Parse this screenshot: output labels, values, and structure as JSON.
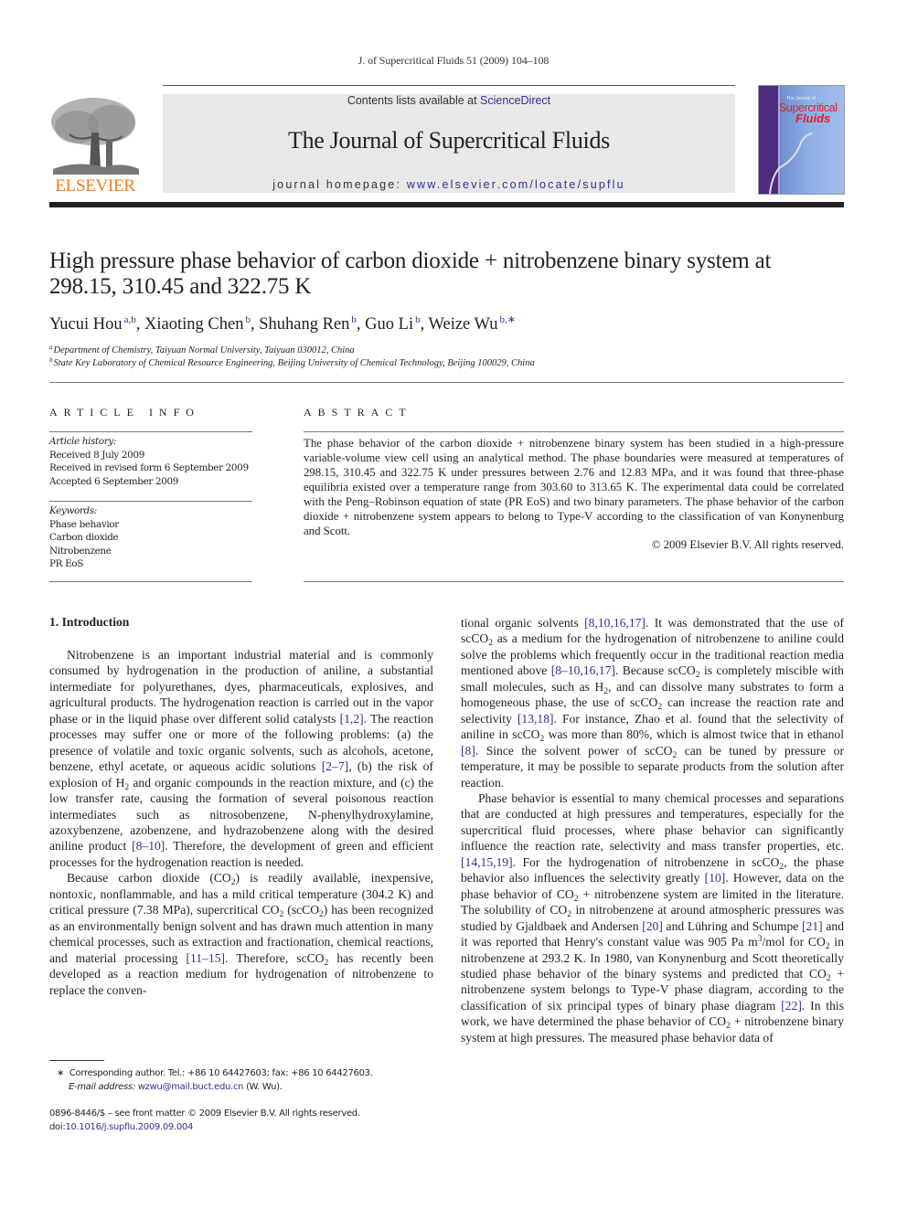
{
  "running_head": "J. of Supercritical Fluids 51 (2009) 104–108",
  "masthead": {
    "publisher_logo_text": "ELSEVIER",
    "contents_prefix": "Contents lists available at ",
    "contents_link": "ScienceDirect",
    "journal_title": "The Journal of Supercritical Fluids",
    "homepage_prefix": "journal homepage: ",
    "homepage_link": "www.elsevier.com/locate/supflu",
    "cover": {
      "small_text": "The Journal of",
      "title_line1": "Supercritical",
      "title_line2": "Fluids"
    },
    "colors": {
      "elsevier_orange": "#f47b20",
      "link_blue": "#2e3192",
      "cover_red": "#e31e24",
      "band_grey": "#e8e8e9"
    }
  },
  "article": {
    "title_line1": "High pressure phase behavior of carbon dioxide + nitrobenzene binary system at",
    "title_line2": "298.15, 310.45 and 322.75 K",
    "authors": [
      {
        "name": "Yucui Hou",
        "affil": "a,b"
      },
      {
        "name": "Xiaoting Chen",
        "affil": "b"
      },
      {
        "name": "Shuhang Ren",
        "affil": "b"
      },
      {
        "name": "Guo Li",
        "affil": "b"
      },
      {
        "name": "Weize Wu",
        "affil": "b,∗"
      }
    ],
    "affiliations": [
      {
        "mark": "a",
        "text": "Department of Chemistry, Taiyuan Normal University, Taiyuan 030012, China"
      },
      {
        "mark": "b",
        "text": "State Key Laboratory of Chemical Resource Engineering, Beijing University of Chemical Technology, Beijing 100029, China"
      }
    ]
  },
  "article_info": {
    "heading": "ARTICLE INFO",
    "history_label": "Article history:",
    "history": [
      "Received 8 July 2009",
      "Received in revised form 6 September 2009",
      "Accepted 6 September 2009"
    ],
    "keywords_label": "Keywords:",
    "keywords": [
      "Phase behavior",
      "Carbon dioxide",
      "Nitrobenzene",
      "PR EoS"
    ]
  },
  "abstract": {
    "heading": "ABSTRACT",
    "text": "The phase behavior of the carbon dioxide + nitrobenzene binary system has been studied in a high-pressure variable-volume view cell using an analytical method. The phase boundaries were measured at temperatures of 298.15, 310.45 and 322.75 K under pressures between 2.76 and 12.83 MPa, and it was found that three-phase equilibria existed over a temperature range from 303.60 to 313.65 K. The experimental data could be correlated with the Peng–Robinson equation of state (PR EoS) and two binary parameters. The phase behavior of the carbon dioxide + nitrobenzene system appears to belong to Type-V according to the classification of van Konynenburg and Scott.",
    "copyright": "© 2009 Elsevier B.V. All rights reserved."
  },
  "intro": {
    "heading": "1.  Introduction",
    "p1": [
      {
        "t": "Nitrobenzene is an important industrial material and is commonly consumed by hydrogenation in the production of aniline, a substantial intermediate for polyurethanes, dyes, pharmaceuticals, explosives, and agricultural products. The hydrogenation reaction is carried out in the vapor phase or in the liquid phase over different solid catalysts "
      },
      {
        "r": "[1,2]"
      },
      {
        "t": ". The reaction processes may suffer one or more of the following problems: (a) the presence of volatile and toxic organic solvents, such as alcohols, acetone, benzene, ethyl acetate, or aqueous acidic solutions "
      },
      {
        "r": "[2–7]"
      },
      {
        "t": ", (b) the risk of explosion of H"
      },
      {
        "s": "2"
      },
      {
        "t": " and organic compounds in the reaction mixture, and (c) the low transfer rate, causing the formation of several poisonous reaction intermediates such as nitrosobenzene, N-phenylhydroxylamine, azoxybenzene, azobenzene, and hydrazobenzene along with the desired aniline product "
      },
      {
        "r": "[8–10]"
      },
      {
        "t": ". Therefore, the development of green and efficient processes for the hydrogenation reaction is needed."
      }
    ],
    "p2": [
      {
        "t": "Because carbon dioxide (CO"
      },
      {
        "s": "2"
      },
      {
        "t": ") is readily available, inexpensive, nontoxic, nonflammable, and has a mild critical temperature (304.2 K) and critical pressure (7.38 MPa), supercritical CO"
      },
      {
        "s": "2"
      },
      {
        "t": " (scCO"
      },
      {
        "s": "2"
      },
      {
        "t": ") has been recognized as an environmentally benign solvent and has drawn much attention in many chemical processes, such as extraction and fractionation, chemical reactions, and material processing "
      },
      {
        "r": "[11–15]"
      },
      {
        "t": ". Therefore, scCO"
      },
      {
        "s": "2"
      },
      {
        "t": " has recently been developed as a reaction medium for hydrogenation of nitrobenzene to replace the conventional organic solvents "
      },
      {
        "r": "[8,10,16,17]"
      },
      {
        "t": ". It was demonstrated that the use of scCO"
      },
      {
        "s": "2"
      },
      {
        "t": " as a medium for the hydrogenation of nitrobenzene to aniline could solve the problems which frequently occur in the traditional reaction media mentioned above "
      },
      {
        "r": "[8–10,16,17]"
      },
      {
        "t": ". Because scCO"
      },
      {
        "s": "2"
      },
      {
        "t": " is completely miscible with small molecules, such as H"
      },
      {
        "s": "2"
      },
      {
        "t": ", and can dissolve many substrates to form a homogeneous phase, the use of scCO"
      },
      {
        "s": "2"
      },
      {
        "t": " can increase the reaction rate and selectivity "
      },
      {
        "r": "[13,18]"
      },
      {
        "t": ". For instance, Zhao et al. found that the selectivity of aniline in scCO"
      },
      {
        "s": "2"
      },
      {
        "t": " was more than 80%, which is almost twice that in ethanol "
      },
      {
        "r": "[8]"
      },
      {
        "t": ". Since the solvent power of scCO"
      },
      {
        "s": "2"
      },
      {
        "t": " can be tuned by pressure or temperature, it may be possible to separate products from the solution after reaction."
      }
    ],
    "p3": [
      {
        "t": "Phase behavior is essential to many chemical processes and separations that are conducted at high pressures and temperatures, especially for the supercritical fluid processes, where phase behavior can significantly influence the reaction rate, selectivity and mass transfer properties, etc. "
      },
      {
        "r": "[14,15,19]"
      },
      {
        "t": ". For the hydrogenation of nitrobenzene in scCO"
      },
      {
        "s": "2"
      },
      {
        "t": ", the phase behavior also influences the selectivity greatly "
      },
      {
        "r": "[10]"
      },
      {
        "t": ". However, data on the phase behavior of CO"
      },
      {
        "s": "2"
      },
      {
        "t": " + nitrobenzene system are limited in the literature. The solubility of CO"
      },
      {
        "s": "2"
      },
      {
        "t": " in nitrobenzene at around atmospheric pressures was studied by Gjaldbaek and Andersen "
      },
      {
        "r": "[20]"
      },
      {
        "t": " and Lühring and Schumpe "
      },
      {
        "r": "[21]"
      },
      {
        "t": " and it was reported that Henry's constant value was 905 Pa m"
      },
      {
        "u": "3"
      },
      {
        "t": "/mol for CO"
      },
      {
        "s": "2"
      },
      {
        "t": " in nitrobenzene at 293.2 K. In 1980, van Konynenburg and Scott theoretically studied phase behavior of the binary systems and predicted that CO"
      },
      {
        "s": "2"
      },
      {
        "t": " + nitrobenzene system belongs to Type-V phase diagram, according to the classification of six principal types of binary phase diagram "
      },
      {
        "r": "[22]"
      },
      {
        "t": ". In this work, we have determined the phase behavior of CO"
      },
      {
        "s": "2"
      },
      {
        "t": " + nitrobenzene binary system at high pressures. The measured phase behavior data of"
      }
    ]
  },
  "footnotes": {
    "corresponding_mark": "∗",
    "corresponding": "Corresponding author. Tel.: +86 10 64427603; fax: +86 10 64427603.",
    "email_label": "E-mail address: ",
    "email": "wzwu@mail.buct.edu.cn",
    "email_suffix": " (W. Wu).",
    "issn_line": "0896-8446/$ – see front matter © 2009 Elsevier B.V. All rights reserved.",
    "doi_prefix": "doi:",
    "doi": "10.1016/j.supflu.2009.09.004"
  }
}
